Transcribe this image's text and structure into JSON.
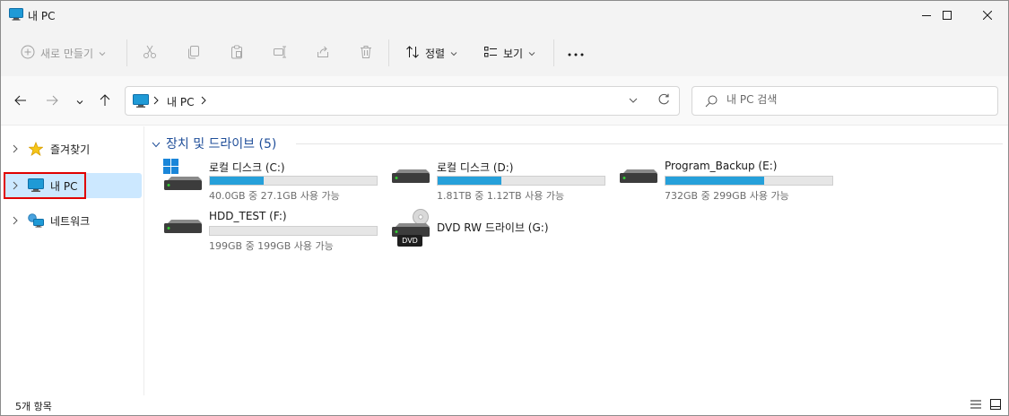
{
  "window": {
    "title": "내 PC"
  },
  "toolbar": {
    "new_label": "새로 만들기",
    "sort_label": "정렬",
    "view_label": "보기",
    "more_label": "···"
  },
  "address": {
    "crumb": "내 PC"
  },
  "search": {
    "placeholder": "내 PC 검색"
  },
  "sidebar": {
    "items": [
      {
        "label": "즐겨찾기",
        "icon": "star-icon"
      },
      {
        "label": "내 PC",
        "icon": "computer-icon",
        "selected": true
      },
      {
        "label": "네트워크",
        "icon": "network-icon"
      }
    ]
  },
  "content": {
    "group_title": "장치 및 드라이브 (5)",
    "drives": [
      {
        "name": "로컬 디스크 (C:)",
        "info": "40.0GB 중 27.1GB 사용 가능",
        "used_fraction": 0.32,
        "windows_logo": true
      },
      {
        "name": "로컬 디스크 (D:)",
        "info": "1.81TB 중 1.12TB 사용 가능",
        "used_fraction": 0.38
      },
      {
        "name": "Program_Backup (E:)",
        "info": "732GB 중 299GB 사용 가능",
        "used_fraction": 0.59
      },
      {
        "name": "HDD_TEST (F:)",
        "info": "199GB 중 199GB 사용 가능",
        "used_fraction": 0.0
      },
      {
        "name": "DVD RW 드라이브 (G:)",
        "dvd_badge": "DVD",
        "optical": true
      }
    ]
  },
  "statusbar": {
    "count": "5개 항목"
  },
  "colors": {
    "accent": "#26a0da",
    "selection": "#cce8ff",
    "group_header": "#1f4e99",
    "highlight_box": "#e00000"
  }
}
